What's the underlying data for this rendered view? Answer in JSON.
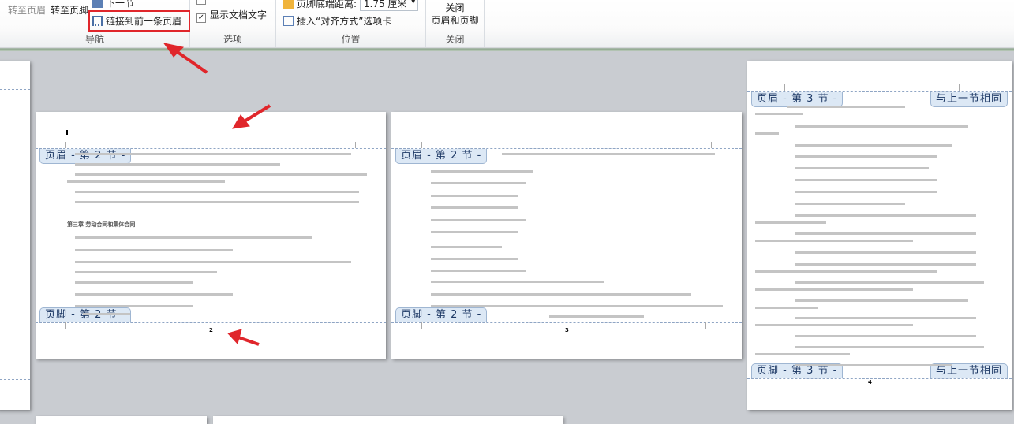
{
  "ribbon": {
    "navigation": {
      "goto_header": "转至页眉",
      "goto_footer": "转至页脚",
      "next_section": "下一节",
      "link_to_previous": "链接到前一条页眉",
      "label": "导航"
    },
    "options": {
      "show_document_text": "显示文档文字",
      "show_document_text_checked": true,
      "label": "选项"
    },
    "position": {
      "footer_distance_label": "页脚底端距离:",
      "footer_distance_value": "1.75 厘米",
      "insert_alignment_tab": "插入“对齐方式”选项卡",
      "label": "位置"
    },
    "close": {
      "close_button": "关闭\n页眉和页脚",
      "label": "关闭"
    }
  },
  "pages": [
    {
      "header_tab": "页眉 - 第 2 节 -",
      "footer_tab": "页脚 - 第 2 节 -",
      "chapter_heading": "第三章 劳动合同和集体合同",
      "page_number": "2"
    },
    {
      "header_tab": "页眉 - 第 2 节 -",
      "footer_tab": "页脚 - 第 2 节 -",
      "page_number": "3"
    },
    {
      "header_tab": "页眉 - 第 3 节 -",
      "footer_tab": "页脚 - 第 3 节 -",
      "same_as_previous": "与上一节相同",
      "page_number": "4"
    }
  ],
  "annotation_color": "#e0262b"
}
